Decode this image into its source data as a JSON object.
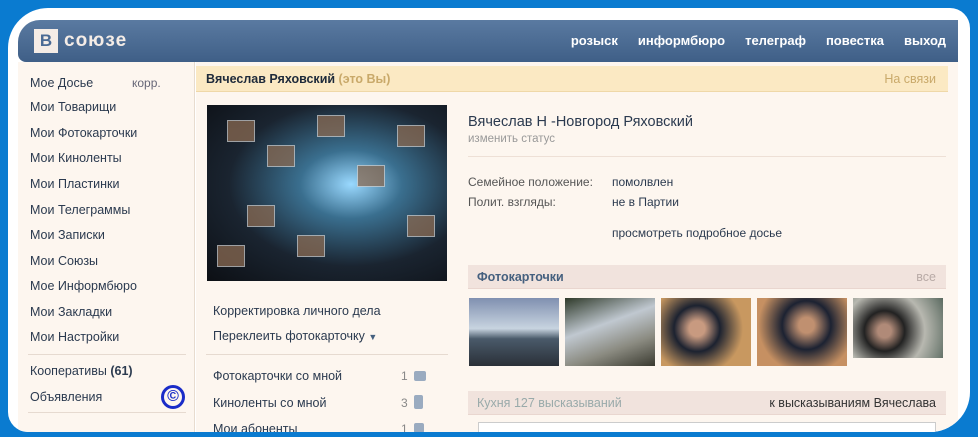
{
  "header": {
    "logo_letter": "В",
    "logo_text": "союзе",
    "nav": [
      "розыск",
      "информбюро",
      "телеграф",
      "повестка",
      "выход"
    ]
  },
  "sidebar": {
    "items": [
      "Мое Досье",
      "Мои Товарищи",
      "Мои Фотокарточки",
      "Мои Киноленты",
      "Мои Пластинки",
      "Мои Телеграммы",
      "Мои Записки",
      "Мои Союзы",
      "Мое Информбюро",
      "Мои Закладки",
      "Мои Настройки"
    ],
    "edit_link": "корр.",
    "cooperatives_label": "Кооперативы",
    "cooperatives_count": "(61)",
    "ads": "Объявления",
    "copyright_symbol": "©"
  },
  "profile": {
    "name_bar": "Вячеслав Ряховский",
    "you_label": "(это Вы)",
    "online": "На связи",
    "full_name": "Вячеслав Н -Новгород Ряховский",
    "change_status": "изменить статус",
    "fields": [
      {
        "key": "Семейное положение:",
        "value": "помолвлен"
      },
      {
        "key": "Полит. взгляды:",
        "value": "не в Партии"
      }
    ],
    "details_link": "просмотреть подробное досье",
    "actions": [
      "Корректировка личного дела",
      "Переклеить фотокарточку"
    ],
    "counters": [
      {
        "label": "Фотокарточки со мной",
        "count": "1"
      },
      {
        "label": "Киноленты со мной",
        "count": "3"
      },
      {
        "label": "Мои абоненты",
        "count": "1"
      }
    ]
  },
  "photos": {
    "title": "Фотокарточки",
    "all": "все",
    "colors": [
      "#6f7f95",
      "#8a8a78",
      "#a77d55",
      "#8b6a4e",
      "#9a9a92"
    ]
  },
  "wall": {
    "title": "Кухня",
    "count": "127 высказываний",
    "link": "к высказываниям Вячеслава"
  }
}
